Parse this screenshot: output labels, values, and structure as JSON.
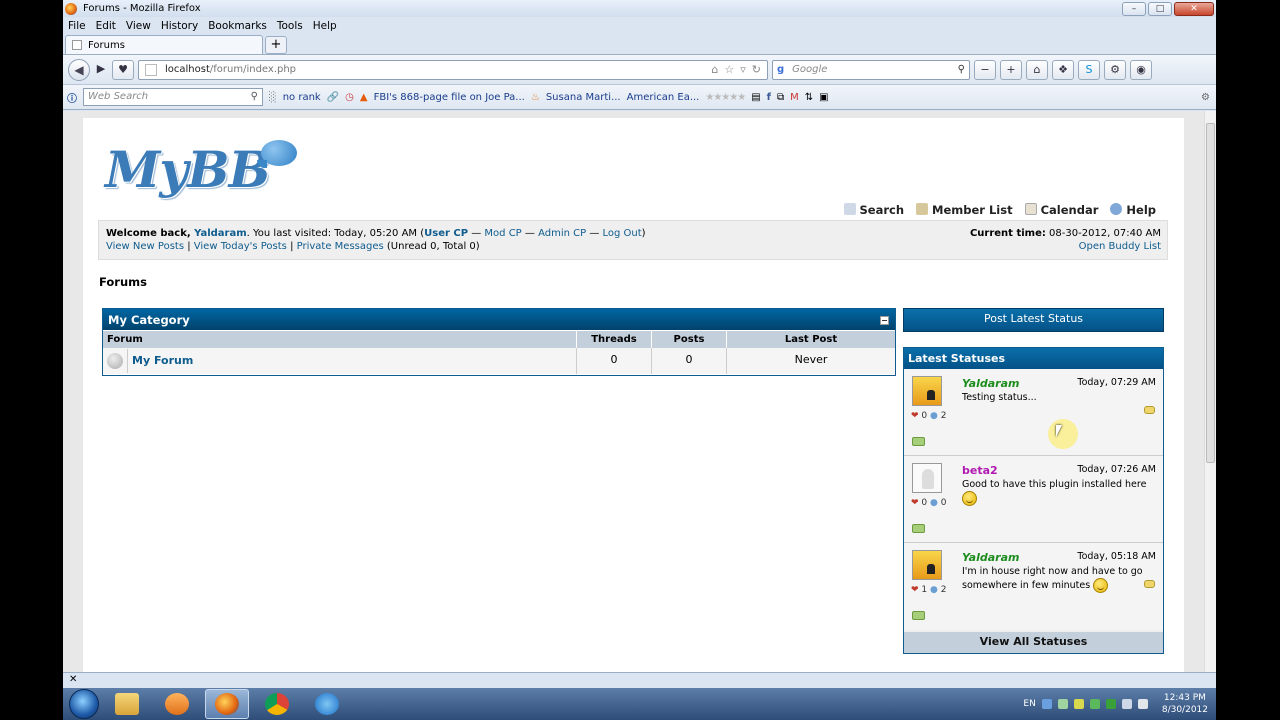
{
  "window": {
    "title": "Forums - Mozilla Firefox",
    "controls": {
      "minimize": "–",
      "maximize": "□",
      "close": "✕"
    }
  },
  "menu": [
    "File",
    "Edit",
    "View",
    "History",
    "Bookmarks",
    "Tools",
    "Help"
  ],
  "tab": {
    "label": "Forums",
    "new_tab": "+"
  },
  "nav": {
    "url_host": "localhost",
    "url_path": "/forum/index.php",
    "search_placeholder": "Google",
    "search_engine_icon": "google-icon"
  },
  "toolbar2": {
    "web_search_placeholder": "Web Search",
    "rank": "no rank",
    "bookmark1": "FBI's 868-page file on Joe Pa...",
    "bookmark2": "Susana Marti...",
    "bookmark3": "American Ea..."
  },
  "site": {
    "logo": "MyBB",
    "top_links": [
      "Search",
      "Member List",
      "Calendar",
      "Help"
    ],
    "welcome": {
      "prefix": "Welcome back, ",
      "username": "Yaldaram",
      "visited": ". You last visited: Today, 05:20 AM (",
      "user_cp": "User CP",
      "mod_cp": "Mod CP",
      "admin_cp": "Admin CP",
      "logout": "Log Out",
      "close_paren": ")",
      "dash": " — ",
      "new_posts": "View New Posts",
      "todays_posts": "View Today's Posts",
      "pm": "Private Messages",
      "pm_counts": "(Unread 0, Total 0)",
      "sep": " | ",
      "current_time_label": "Current time:",
      "current_time": "08-30-2012, 07:40 AM",
      "buddy_list": "Open Buddy List"
    },
    "breadcrumb": "Forums"
  },
  "forum_table": {
    "category": "My Category",
    "columns": [
      "Forum",
      "Threads",
      "Posts",
      "Last Post"
    ],
    "rows": [
      {
        "name": "My Forum",
        "threads": "0",
        "posts": "0",
        "last_post": "Never"
      }
    ]
  },
  "sidebar": {
    "post_status": "Post Latest Status",
    "latest_title": "Latest Statuses",
    "view_all": "View All Statuses",
    "statuses": [
      {
        "user": "Yaldaram",
        "time": "Today, 07:29 AM",
        "text": "Testing status...",
        "likes": "0",
        "comments": "2"
      },
      {
        "user": "beta2",
        "time": "Today, 07:26 AM",
        "text": "Good to have this plugin installed here",
        "likes": "0",
        "comments": "0"
      },
      {
        "user": "Yaldaram",
        "time": "Today, 05:18 AM",
        "text": "I'm in house right now and have to go somewhere in few minutes",
        "likes": "1",
        "comments": "2"
      }
    ]
  },
  "statusbar": {
    "close": "✕"
  },
  "taskbar": {
    "lang": "EN",
    "time": "12:43 PM",
    "date": "8/30/2012"
  },
  "colors": {
    "brand": "#0f5c8e",
    "header": "#045287",
    "green_user": "#1c8d1c",
    "purple_user": "#b01ab0"
  }
}
